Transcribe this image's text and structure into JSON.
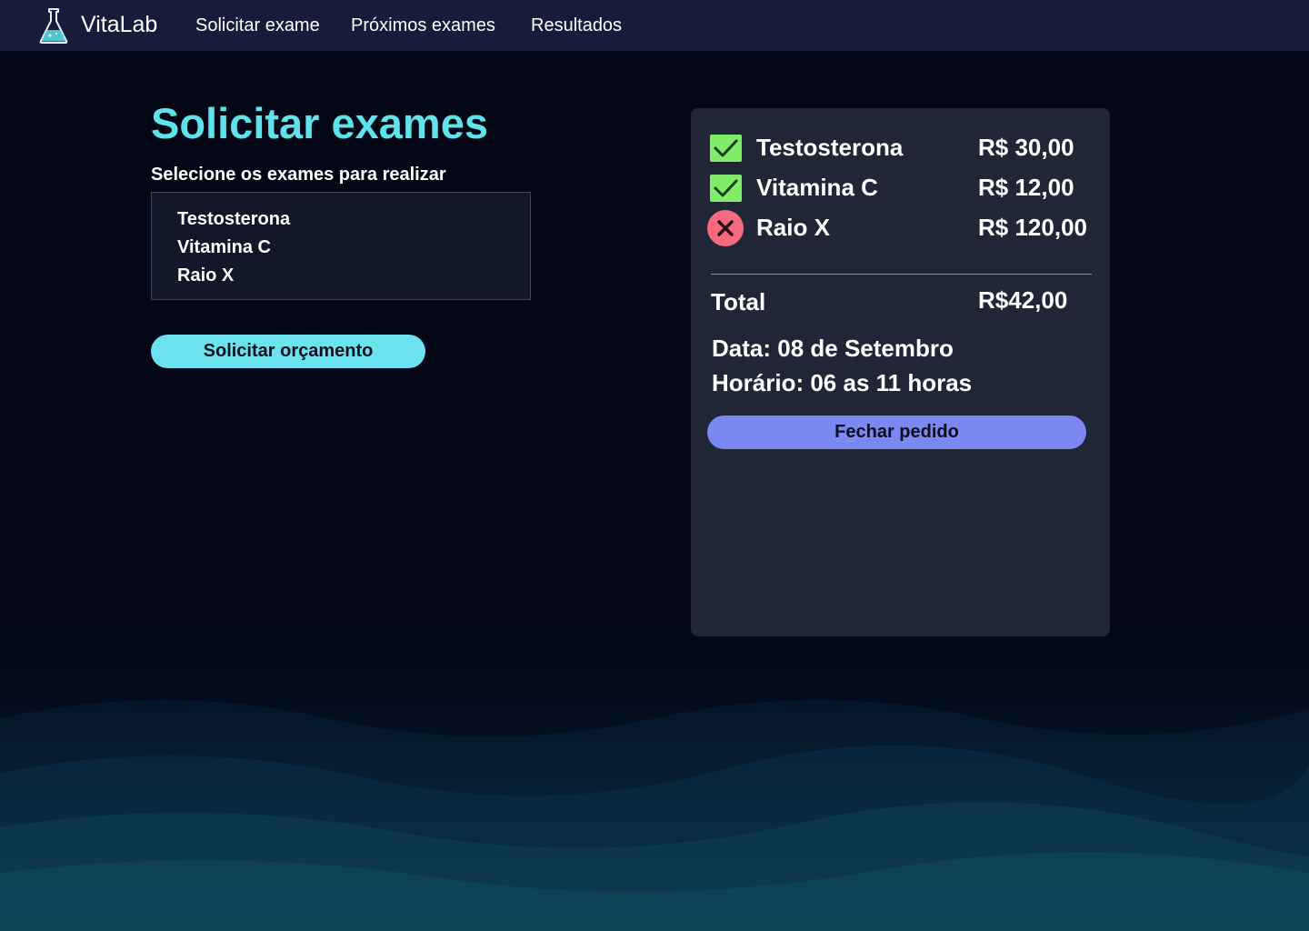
{
  "colors": {
    "background": "#020615",
    "navbar": "#171c3a",
    "accent_cyan": "#5ee3ea",
    "button_quote": "#6be3ee",
    "button_close": "#7b87f2",
    "panel": "#212636",
    "check_green": "#7fed67",
    "error_red": "#f56a7c"
  },
  "nav": {
    "logo_icon": "flask-icon",
    "brand": "VitaLab",
    "links": [
      "Solicitar exame",
      "Próximos exames",
      "Resultados"
    ]
  },
  "main": {
    "title": "Solicitar exames",
    "select_label": "Selecione os exames para realizar",
    "options": [
      "Testosterona",
      "Vitamina C",
      "Raio X"
    ],
    "quote_button": "Solicitar orçamento"
  },
  "summary": {
    "items": [
      {
        "name": "Testosterona",
        "price": "R$ 30,00",
        "status": "check-icon"
      },
      {
        "name": "Vitamina C",
        "price": "R$ 12,00",
        "status": "check-icon"
      },
      {
        "name": "Raio X",
        "price": "R$ 120,00",
        "status": "x-circle-icon"
      }
    ],
    "total_label": "Total",
    "total_value": "R$42,00",
    "date": "Data: 08 de Setembro",
    "time": "Horário: 06 as 11 horas",
    "close_button": "Fechar pedido"
  }
}
